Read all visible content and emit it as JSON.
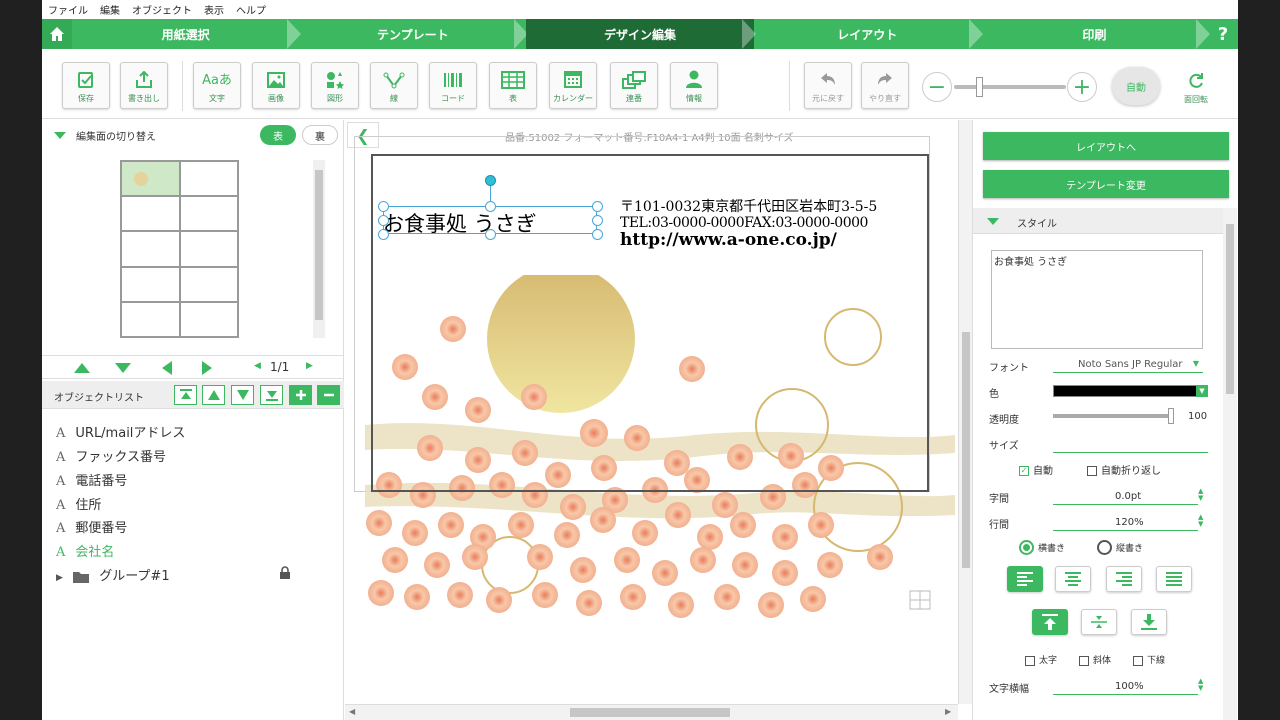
{
  "menu": {
    "items": [
      "ファイル",
      "編集",
      "オブジェクト",
      "表示",
      "ヘルプ"
    ]
  },
  "steps": [
    "用紙選択",
    "テンプレート",
    "デザイン編集",
    "レイアウト",
    "印刷"
  ],
  "help_label": "?",
  "toolbar": {
    "save": "保存",
    "export": "書き出し",
    "text": "文字",
    "image": "画像",
    "shape": "図形",
    "line": "線",
    "code": "コード",
    "table": "表",
    "calendar": "カレンダー",
    "serial": "連番",
    "info": "情報",
    "undo": "元に戻す",
    "redo": "やり直す",
    "auto": "自動",
    "rotate": "面回転",
    "text_icon_glyph": "Aaあ"
  },
  "left": {
    "switch_title": "編集面の切り替え",
    "front": "表",
    "back": "裏",
    "page": "1/1",
    "object_list_title": "オブジェクトリスト",
    "objects": [
      {
        "icon": "A",
        "label": "URL/mailアドレス"
      },
      {
        "icon": "A",
        "label": "ファックス番号"
      },
      {
        "icon": "A",
        "label": "電話番号"
      },
      {
        "icon": "A",
        "label": "住所"
      },
      {
        "icon": "A",
        "label": "郵便番号"
      },
      {
        "icon": "A",
        "label": "会社名"
      }
    ],
    "group_label": "グループ#1"
  },
  "canvas": {
    "header": "品番:51002 フォーマット番号:F10A4-1 A4判 10面 名刺サイズ",
    "company": "お食事処 うさぎ",
    "address": "〒101-0032東京都千代田区岩本町3-5-5",
    "telfax": "TEL:03-0000-0000FAX:03-0000-0000",
    "url": "http://www.a-one.co.jp/",
    "collapse": "❮"
  },
  "right": {
    "to_layout": "レイアウトへ",
    "change_template": "テンプレート変更",
    "style_title": "スタイル",
    "text_value": "お食事処 うさぎ",
    "font_label": "フォント",
    "font_value": "Noto Sans JP Regular",
    "color_label": "色",
    "opacity_label": "透明度",
    "opacity_value": "100",
    "opacity_fraction": 0.98,
    "size_label": "サイズ",
    "auto_label": "自動",
    "wrap_label": "自動折り返し",
    "char_spacing_label": "字間",
    "char_spacing_value": "0.0pt",
    "line_spacing_label": "行間",
    "line_spacing_value": "120%",
    "horizontal_label": "横書き",
    "vertical_label": "縦書き",
    "bold_label": "太字",
    "italic_label": "斜体",
    "underline_label": "下線",
    "char_width_label": "文字横幅",
    "char_width_value": "100%"
  },
  "colors": {
    "accent": "#3cb860",
    "active_step": "#1f6b36",
    "text_color": "#000000"
  }
}
